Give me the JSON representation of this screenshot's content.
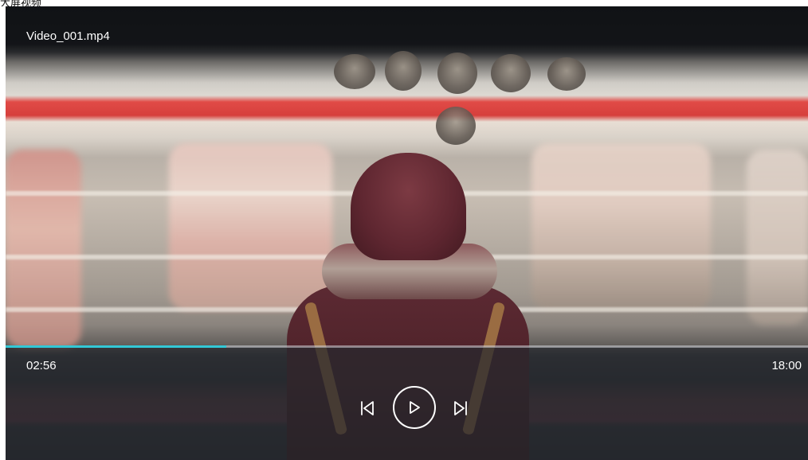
{
  "page": {
    "top_strip_text": "大屏视频"
  },
  "player": {
    "title": "Video_001.mp4",
    "current_time": "02:56",
    "total_time": "18:00",
    "progress_fraction": 0.2748,
    "accent_color": "#32c8d6",
    "controls": {
      "previous_icon": "skip-previous-icon",
      "play_icon": "play-icon",
      "next_icon": "skip-next-icon"
    }
  }
}
